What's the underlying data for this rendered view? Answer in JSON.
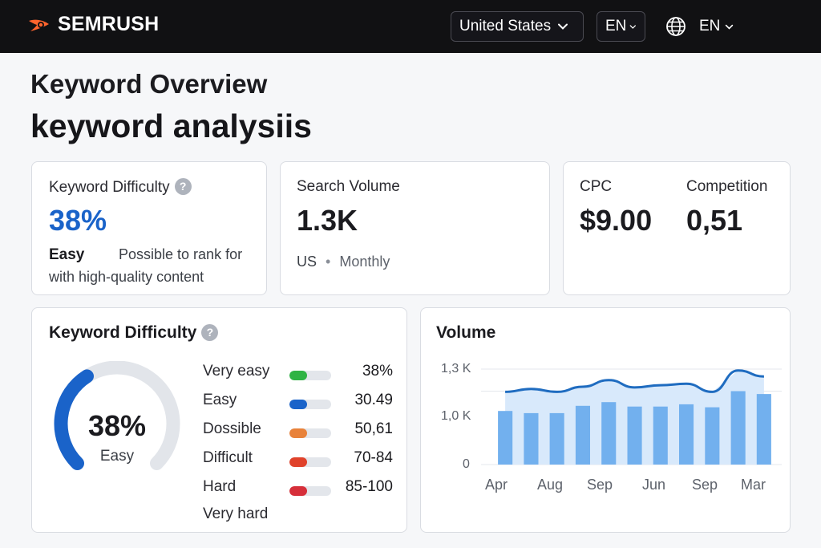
{
  "header": {
    "brand": "SEMRUSH",
    "country": "United States",
    "db_lang": "EN",
    "ui_lang": "EN"
  },
  "page": {
    "subtitle": "Keyword Overview",
    "keyword": "keyword analysiis"
  },
  "cards": {
    "difficulty": {
      "label": "Keyword Difficulty",
      "value": "38%",
      "level": "Easy",
      "description_1": "Possible to rank for",
      "description_2": "with high-quality content",
      "accent": "#1a63c9"
    },
    "volume": {
      "label": "Search Volume",
      "value": "1.3K",
      "country": "US",
      "period": "Monthly"
    },
    "cpc": {
      "label": "CPC",
      "value": "$9.00"
    },
    "competition": {
      "label": "Competition",
      "value": "0,51"
    }
  },
  "kd_panel": {
    "title": "Keyword Difficulty",
    "gauge_value": "38%",
    "gauge_label": "Easy",
    "gauge_fraction": 0.38,
    "rows": [
      {
        "label": "Very easy",
        "value": "38%",
        "color": "#2fb344"
      },
      {
        "label": "Easy",
        "value": "30.49",
        "color": "#1a63c9"
      },
      {
        "label": "Dossible",
        "value": "50,61",
        "color": "#e8823a"
      },
      {
        "label": "Difficult",
        "value": "70-84",
        "color": "#e0422b"
      },
      {
        "label": "Hard",
        "value": "85-100",
        "color": "#d62f3a"
      },
      {
        "label": "Very hard",
        "value": "",
        "color": ""
      }
    ]
  },
  "volume_panel": {
    "title": "Volume"
  },
  "chart_data": {
    "type": "bar",
    "title": "Volume",
    "y_ticks": [
      "1,3 K",
      "1,0 K",
      "0"
    ],
    "x_tick_labels": [
      "Apr",
      "Aug",
      "Sep",
      "Jun",
      "Sep",
      "Mar"
    ],
    "ylim": [
      0,
      1300
    ],
    "bars": [
      730,
      700,
      700,
      800,
      850,
      790,
      790,
      820,
      780,
      1000,
      960
    ],
    "line": [
      990,
      1030,
      990,
      1060,
      1150,
      1050,
      1080,
      1100,
      990,
      1280,
      1200
    ],
    "colors": {
      "bar": "#72b0ee",
      "line": "#1f6cc0",
      "area": "#d8e9fb"
    },
    "grid": true
  }
}
